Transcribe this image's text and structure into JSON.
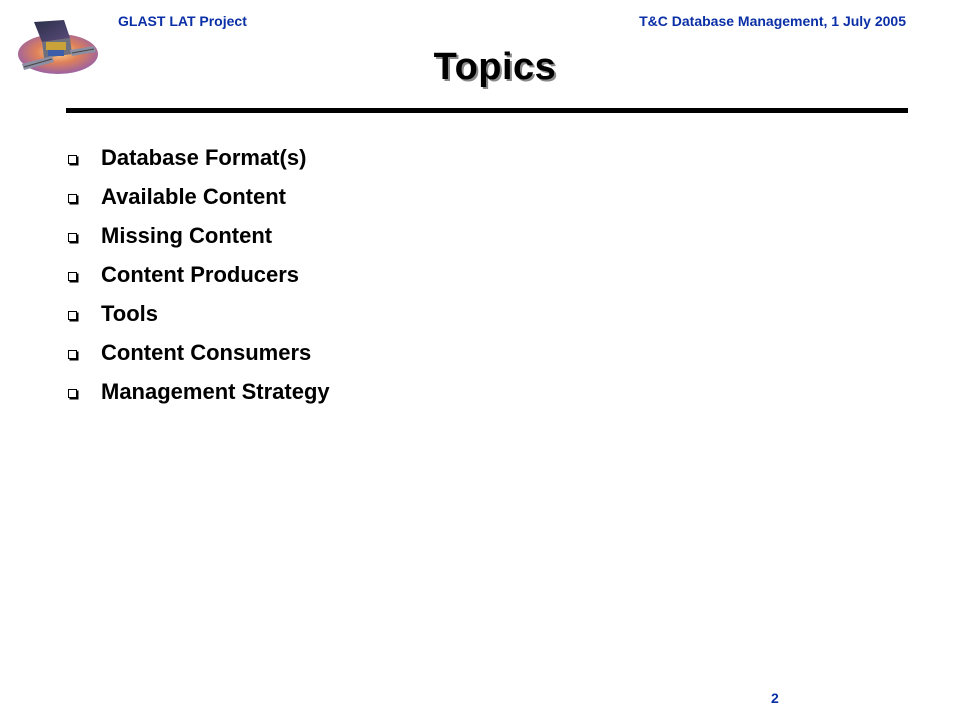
{
  "header": {
    "project": "GLAST LAT Project",
    "meeting": "T&C Database Management, 1 July 2005"
  },
  "logo": {
    "icon": "glast-satellite-logo-icon"
  },
  "title": "Topics",
  "bullets": [
    "Database Format(s)",
    "Available Content",
    "Missing Content",
    "Content Producers",
    "Tools",
    "Content Consumers",
    "Management Strategy"
  ],
  "page_number": "2",
  "colors": {
    "header_text": "#0b2fa6",
    "title_text": "#000000",
    "rule": "#000000"
  }
}
